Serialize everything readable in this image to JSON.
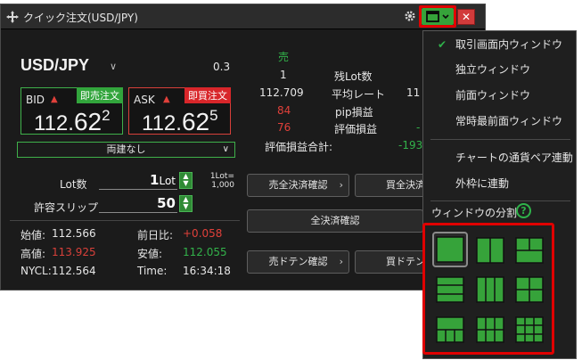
{
  "window": {
    "title": "クイック注文(USD/JPY)",
    "close_glyph": "✕",
    "icons": [
      "move-icon",
      "gear-icon",
      "window-layout-icon",
      "close-icon"
    ]
  },
  "pair": {
    "name": "USD/JPY",
    "spread": "0.3"
  },
  "bid": {
    "label": "BID",
    "tag": "即売注文",
    "price_small": "112.",
    "price_big": "62",
    "price_sup": "2"
  },
  "ask": {
    "label": "ASK",
    "tag": "即買注文",
    "price_small": "112.",
    "price_big": "62",
    "price_sup": "5"
  },
  "ryodate": "両建なし",
  "lot": {
    "label": "Lot数",
    "value": "1",
    "unit": "Lot",
    "note_line1": "1Lot=",
    "note_line2": "1,000"
  },
  "slippage": {
    "label": "許容スリップ",
    "value": "50"
  },
  "stats": {
    "open_label": "始値:",
    "open": "112.566",
    "prevdiff_label": "前日比:",
    "prevdiff": "+0.058",
    "high_label": "高値:",
    "high": "113.925",
    "low_label": "安値:",
    "low": "112.055",
    "nycl_label": "NYCL:",
    "nycl": "112.564",
    "time_label": "Time:",
    "time": "16:34:18"
  },
  "positions": {
    "side": "売",
    "lot_remaining": "1",
    "lot_remaining_label": "残Lot数",
    "avg_rate": "112.709",
    "avg_rate_label": "平均レート",
    "avg_rate_right": "11",
    "pip": "84",
    "pip_label": "pip損益",
    "unrealized": "76",
    "unrealized_label": "評価損益",
    "unrealized_right": "-",
    "total_label": "評価損益合計:",
    "total_value": "-193"
  },
  "buttons": {
    "sell_close": "売全決済確認",
    "buy_close": "買全決済",
    "all_close": "全決済確認",
    "sell_doten": "売ドテン確認",
    "buy_doten": "買ドテン"
  },
  "menu": {
    "items": [
      {
        "label": "取引画面内ウィンドウ",
        "checked": true
      },
      {
        "label": "独立ウィンドウ",
        "checked": false
      },
      {
        "label": "前面ウィンドウ",
        "checked": false
      },
      {
        "label": "常時最前面ウィンドウ",
        "checked": false
      },
      {
        "label": "チャートの通貨ペア連動",
        "checked": false
      },
      {
        "label": "外枠に連動",
        "checked": false
      }
    ],
    "split_title": "ウィンドウの分割",
    "help_glyph": "?",
    "check_glyph": "✔"
  },
  "colors": {
    "green": "#36a33a",
    "red": "#d8262a",
    "up": "#e0403a",
    "pip_red": "#e0403a",
    "total_green": "#32b24a",
    "high_red": "#d8403a",
    "low_green": "#32b24a"
  }
}
